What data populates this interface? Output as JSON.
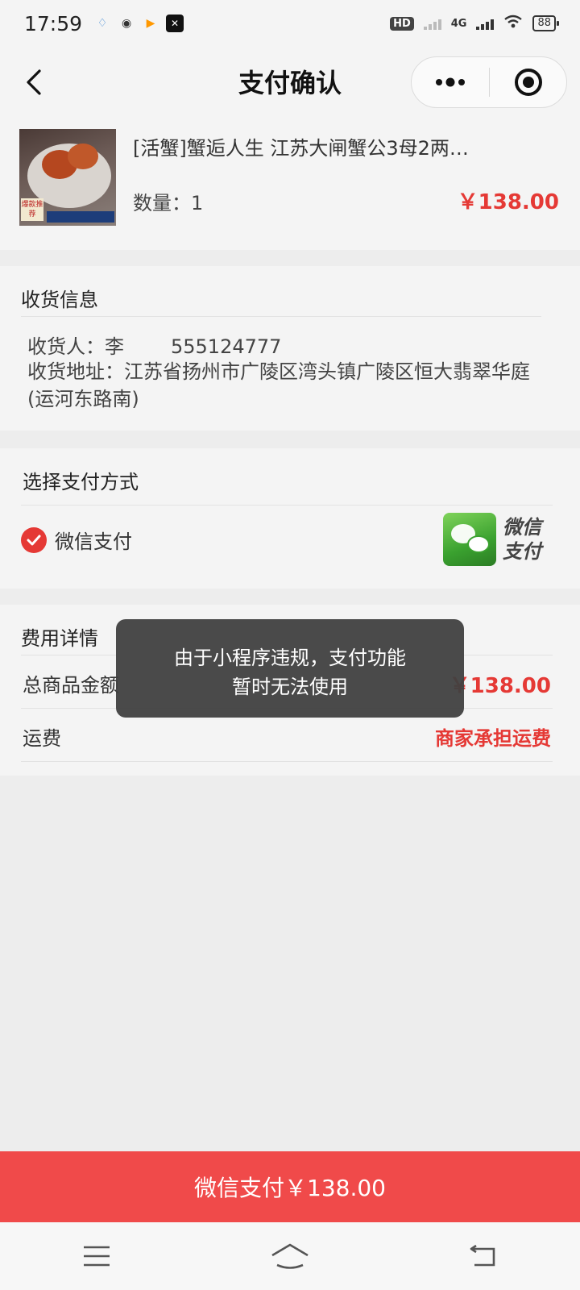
{
  "status_bar": {
    "time": "17:59",
    "hd_badge": "HD",
    "network": "4G",
    "battery": "88"
  },
  "nav": {
    "title": "支付确认"
  },
  "product": {
    "title": "[活蟹]蟹逅人生 江苏大闸蟹公3母2两…",
    "quantity_label": "数量：1",
    "price": "￥138.00",
    "thumb_badge": "爆款推荐"
  },
  "address": {
    "section_title": "收货信息",
    "recipient": "收货人：李",
    "phone": "555124777",
    "address_line": "收货地址：江苏省扬州市广陵区湾头镇广陵区恒大翡翠华庭(运河东路南)"
  },
  "payment": {
    "section_title": "选择支付方式",
    "option_label": "微信支付",
    "logo_text_1": "微信",
    "logo_text_2": "支付",
    "selected": true
  },
  "fees": {
    "section_title": "费用详情",
    "total_label": "总商品金额",
    "total_value": "￥138.00",
    "shipping_label": "运费",
    "shipping_value": "商家承担运费"
  },
  "toast": {
    "line1": "由于小程序违规，支付功能",
    "line2": "暂时无法使用"
  },
  "footer": {
    "pay_button": "微信支付￥138.00"
  },
  "colors": {
    "accent_red": "#e53935",
    "button_red": "#f04a4a",
    "background": "#ededed",
    "toast_bg": "#404040"
  }
}
